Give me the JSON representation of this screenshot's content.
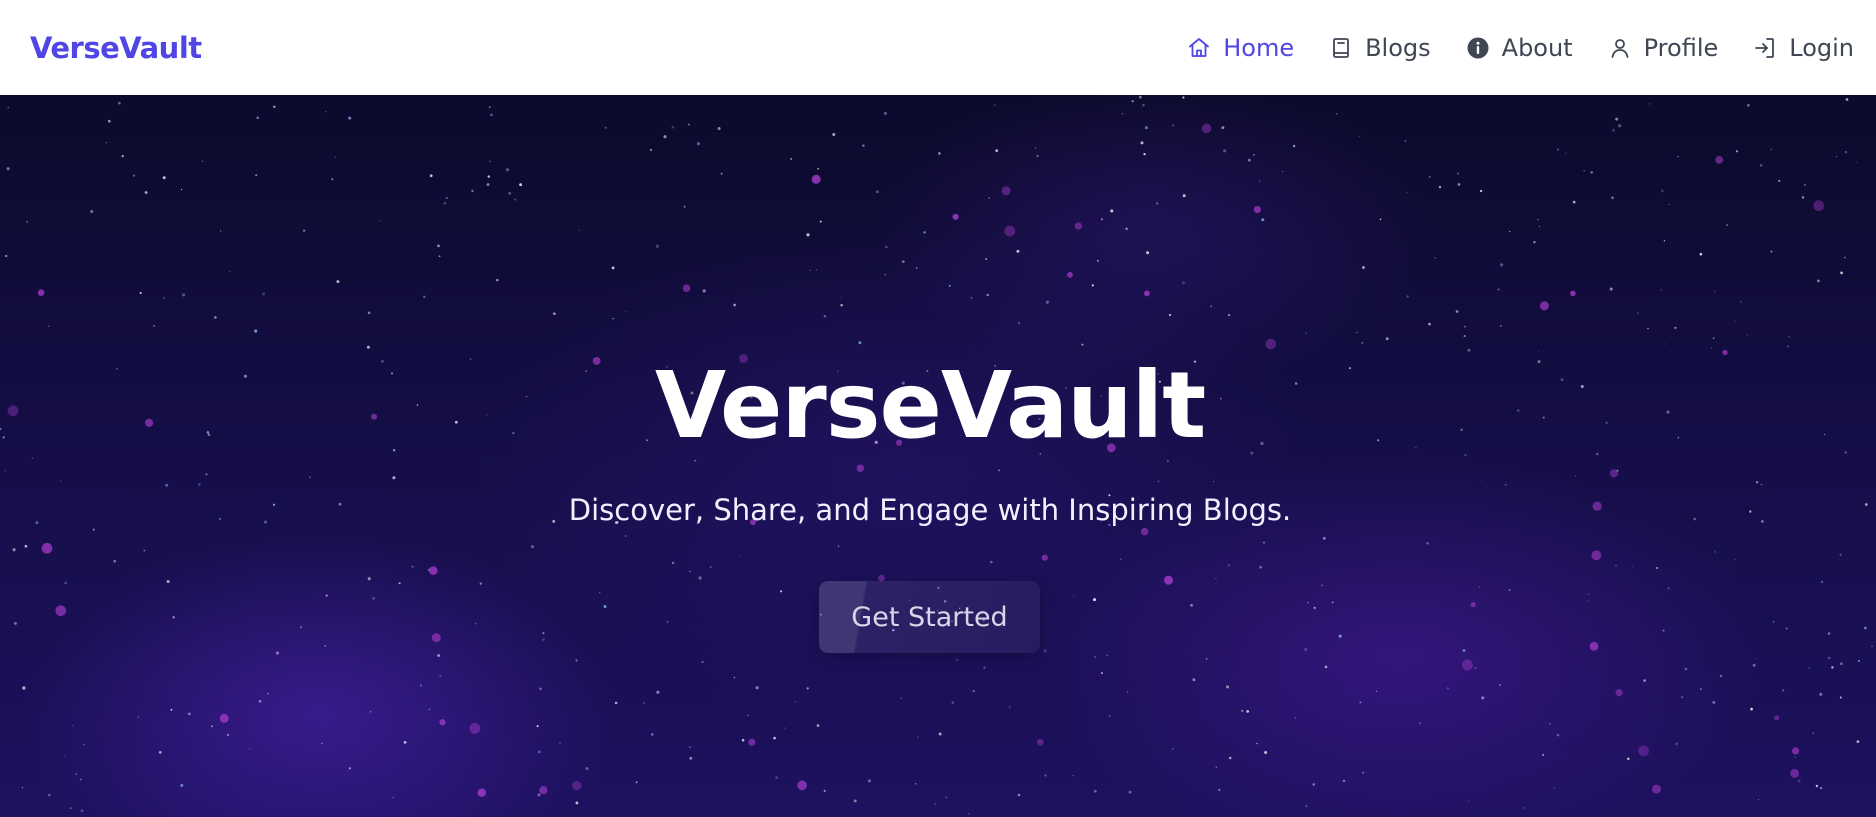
{
  "brand": {
    "name": "VerseVault"
  },
  "nav": {
    "items": [
      {
        "label": "Home",
        "icon": "home-icon",
        "active": true
      },
      {
        "label": "Blogs",
        "icon": "book-icon",
        "active": false
      },
      {
        "label": "About",
        "icon": "info-icon",
        "active": false
      },
      {
        "label": "Profile",
        "icon": "user-icon",
        "active": false
      },
      {
        "label": "Login",
        "icon": "login-icon",
        "active": false
      }
    ]
  },
  "hero": {
    "title": "VerseVault",
    "subtitle": "Discover, Share, and Engage with Inspiring Blogs.",
    "cta_label": "Get Started"
  },
  "colors": {
    "accent": "#4f46e5",
    "nav_text": "#3f4654",
    "hero_bg": "#140e45",
    "hero_text": "#ffffff"
  }
}
